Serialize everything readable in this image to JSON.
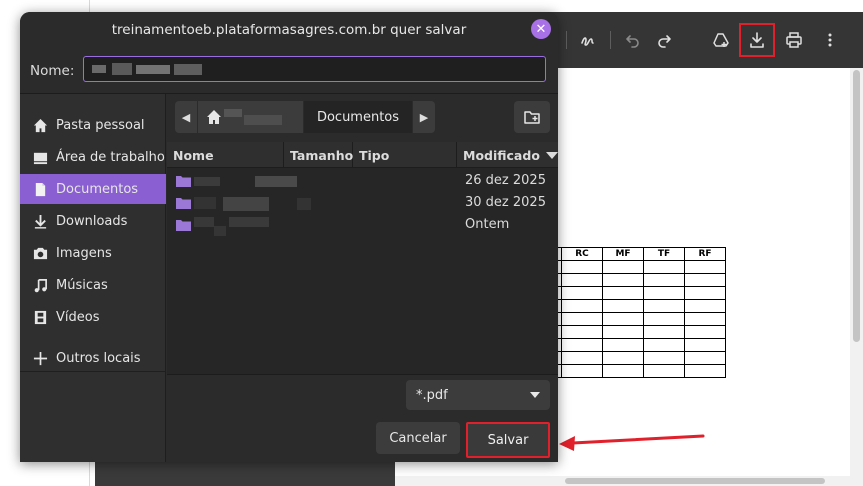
{
  "dialog": {
    "title": "treinamentoeb.plataformasagres.com.br quer salvar",
    "name_label": "Nome:",
    "sidebar": [
      {
        "label": "Pasta pessoal",
        "icon": "home-icon",
        "active": false
      },
      {
        "label": "Área de trabalho",
        "icon": "desktop-icon",
        "active": false
      },
      {
        "label": "Documentos",
        "icon": "document-icon",
        "active": true
      },
      {
        "label": "Downloads",
        "icon": "download-icon",
        "active": false
      },
      {
        "label": "Imagens",
        "icon": "camera-icon",
        "active": false
      },
      {
        "label": "Músicas",
        "icon": "music-icon",
        "active": false
      },
      {
        "label": "Vídeos",
        "icon": "film-icon",
        "active": false
      },
      {
        "label": "Outros locais",
        "icon": "plus-icon",
        "active": false
      }
    ],
    "path_current": "Documentos",
    "columns": {
      "name": "Nome",
      "size": "Tamanho",
      "type": "Tipo",
      "modified": "Modificado"
    },
    "files": [
      {
        "modified": "26 dez 2025"
      },
      {
        "modified": "30 dez 2025"
      },
      {
        "modified": "Ontem"
      }
    ],
    "filter": "*.pdf",
    "cancel_label": "Cancelar",
    "save_label": "Salvar"
  },
  "viewer": {
    "table_headers": [
      "RC",
      "MF",
      "TF",
      "RF"
    ]
  },
  "colors": {
    "accent": "#8a5fd1",
    "highlight": "#e0202a",
    "dialog_bg": "#2b2b2b"
  }
}
